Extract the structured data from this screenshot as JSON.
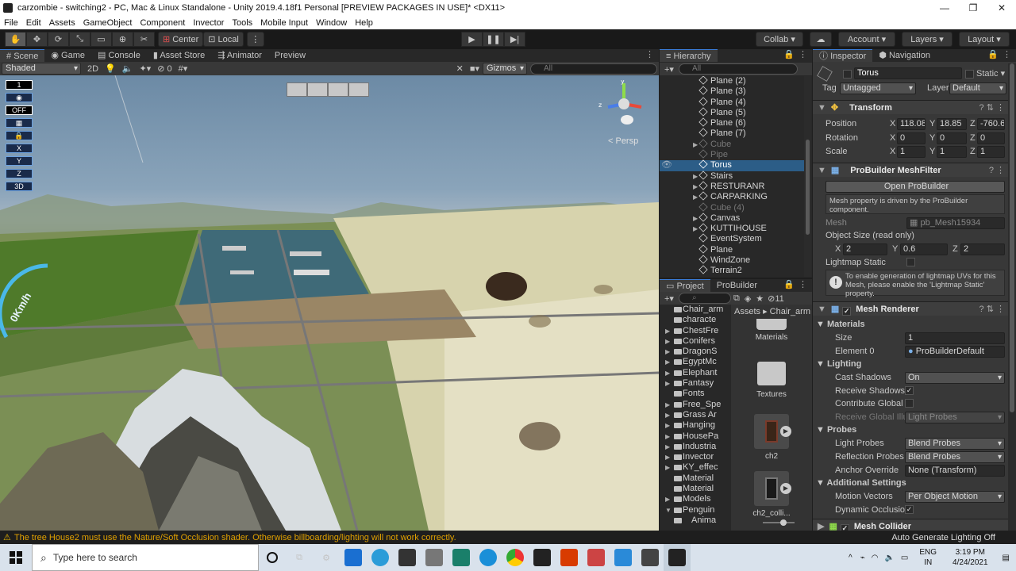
{
  "window": {
    "title": "carzombie - switching2 - PC, Mac & Linux Standalone - Unity 2019.4.18f1 Personal [PREVIEW PACKAGES IN USE]* <DX11>"
  },
  "menu": [
    "File",
    "Edit",
    "Assets",
    "GameObject",
    "Component",
    "Invector",
    "Tools",
    "Mobile Input",
    "Window",
    "Help"
  ],
  "toolbar": {
    "pivot": "Center",
    "space": "Local",
    "collab": "Collab",
    "account": "Account",
    "layers": "Layers",
    "layout": "Layout"
  },
  "scene_tabs": [
    "Scene",
    "Game",
    "Console",
    "Asset Store",
    "Animator",
    "Preview"
  ],
  "scene_toolbar": {
    "shading": "Shaded",
    "mode_2d": "2D",
    "fx_count": "0",
    "gizmos": "Gizmos",
    "search_placeholder": "All"
  },
  "scene": {
    "persp_label": "< Persp",
    "overlay_labels": [
      "1",
      "OFF",
      "X",
      "Y",
      "Z",
      "3D"
    ],
    "speedometer": "0Km/h"
  },
  "hierarchy": {
    "tab": "Hierarchy",
    "search_placeholder": "All",
    "items": [
      {
        "label": "Plane (2)",
        "dim": false,
        "arrow": false,
        "selected": false
      },
      {
        "label": "Plane (3)",
        "dim": false,
        "arrow": false,
        "selected": false
      },
      {
        "label": "Plane (4)",
        "dim": false,
        "arrow": false,
        "selected": false
      },
      {
        "label": "Plane (5)",
        "dim": false,
        "arrow": false,
        "selected": false
      },
      {
        "label": "Plane (6)",
        "dim": false,
        "arrow": false,
        "selected": false
      },
      {
        "label": "Plane (7)",
        "dim": false,
        "arrow": false,
        "selected": false
      },
      {
        "label": "Cube",
        "dim": true,
        "arrow": true,
        "selected": false
      },
      {
        "label": "Pipe",
        "dim": true,
        "arrow": false,
        "selected": false
      },
      {
        "label": "Torus",
        "dim": false,
        "arrow": false,
        "selected": true
      },
      {
        "label": "Stairs",
        "dim": false,
        "arrow": true,
        "selected": false
      },
      {
        "label": "RESTURANR",
        "dim": false,
        "arrow": true,
        "selected": false
      },
      {
        "label": "CARPARKING",
        "dim": false,
        "arrow": true,
        "selected": false
      },
      {
        "label": "Cube (4)",
        "dim": true,
        "arrow": false,
        "selected": false
      },
      {
        "label": "Canvas",
        "dim": false,
        "arrow": true,
        "selected": false
      },
      {
        "label": "KUTTIHOUSE",
        "dim": false,
        "arrow": true,
        "selected": false
      },
      {
        "label": "EventSystem",
        "dim": false,
        "arrow": false,
        "selected": false
      },
      {
        "label": "Plane",
        "dim": false,
        "arrow": false,
        "selected": false
      },
      {
        "label": "WindZone",
        "dim": false,
        "arrow": false,
        "selected": false
      },
      {
        "label": "Terrain2",
        "dim": false,
        "arrow": false,
        "selected": false
      }
    ]
  },
  "project": {
    "tabs": [
      "Project",
      "ProBuilder"
    ],
    "badge": "11",
    "breadcrumb": [
      "Assets",
      "Chair_arm"
    ],
    "folders": [
      {
        "label": "Chair_arm",
        "arrow": false
      },
      {
        "label": "characte",
        "arrow": false
      },
      {
        "label": "ChestFre",
        "arrow": true
      },
      {
        "label": "Conifers",
        "arrow": true
      },
      {
        "label": "DragonS",
        "arrow": true
      },
      {
        "label": "EgyptMc",
        "arrow": true
      },
      {
        "label": "Elephant",
        "arrow": true
      },
      {
        "label": "Fantasy",
        "arrow": true
      },
      {
        "label": "Fonts",
        "arrow": false
      },
      {
        "label": "Free_Spe",
        "arrow": true
      },
      {
        "label": "Grass Ar",
        "arrow": true
      },
      {
        "label": "Hanging",
        "arrow": true
      },
      {
        "label": "HousePa",
        "arrow": true
      },
      {
        "label": "Industria",
        "arrow": true
      },
      {
        "label": "Invector",
        "arrow": true
      },
      {
        "label": "KY_effec",
        "arrow": true
      },
      {
        "label": "Material",
        "arrow": false
      },
      {
        "label": "Material",
        "arrow": false
      },
      {
        "label": "Models",
        "arrow": true
      },
      {
        "label": "Penguin",
        "arrow": true
      },
      {
        "label": "Anima",
        "arrow": false
      }
    ],
    "assets": [
      "Materials",
      "Textures",
      "ch2",
      "ch2_colli..."
    ]
  },
  "inspector": {
    "tabs": [
      "Inspector",
      "Navigation"
    ],
    "object_name": "Torus",
    "static_label": "Static",
    "tag_label": "Tag",
    "tag_value": "Untagged",
    "layer_label": "Layer",
    "layer_value": "Default",
    "transform": {
      "title": "Transform",
      "position": {
        "label": "Position",
        "x": "118.08",
        "y": "18.85",
        "z": "-760.6"
      },
      "rotation": {
        "label": "Rotation",
        "x": "0",
        "y": "0",
        "z": "0"
      },
      "scale": {
        "label": "Scale",
        "x": "1",
        "y": "1",
        "z": "1"
      }
    },
    "meshfilter": {
      "title": "ProBuilder MeshFilter",
      "open_button": "Open ProBuilder",
      "note": "Mesh property is driven by the ProBuilder component.",
      "mesh_label": "Mesh",
      "mesh_value": "pb_Mesh15934",
      "size_label": "Object Size (read only)",
      "size": {
        "x": "2",
        "y": "0.6",
        "z": "2"
      },
      "lightmap_label": "Lightmap Static",
      "lightmap_info": "To enable generation of lightmap UVs for this Mesh, please enable the 'Lightmap Static' property."
    },
    "mesh_renderer": {
      "title": "Mesh Renderer",
      "materials": "Materials",
      "size_label": "Size",
      "size_value": "1",
      "element0_label": "Element 0",
      "element0_value": "ProBuilderDefault",
      "lighting": "Lighting",
      "cast_shadows_label": "Cast Shadows",
      "cast_shadows_value": "On",
      "receive_shadows_label": "Receive Shadows",
      "contribute_gi_label": "Contribute Global",
      "receive_gi_label": "Receive Global Illu",
      "receive_gi_value": "Light Probes",
      "probes": "Probes",
      "light_probes_label": "Light Probes",
      "light_probes_value": "Blend Probes",
      "reflection_probes_label": "Reflection Probes",
      "reflection_probes_value": "Blend Probes",
      "anchor_label": "Anchor Override",
      "anchor_value": "None (Transform)",
      "additional": "Additional Settings",
      "motion_label": "Motion Vectors",
      "motion_value": "Per Object Motion",
      "dynamic_occ_label": "Dynamic Occlusio"
    },
    "mesh_collider": {
      "title": "Mesh Collider"
    }
  },
  "status": {
    "message": "The tree House2 must use the Nature/Soft Occlusion shader. Otherwise billboarding/lighting will not work correctly.",
    "right": "Auto Generate Lighting Off"
  },
  "taskbar": {
    "search_placeholder": "Type here to search",
    "lang": "ENG",
    "region": "IN",
    "time": "3:19 PM",
    "date": "4/24/2021"
  },
  "colors": {
    "selection": "#2c5d87",
    "accent": "#3a7bd5",
    "warning": "#e8b400"
  }
}
